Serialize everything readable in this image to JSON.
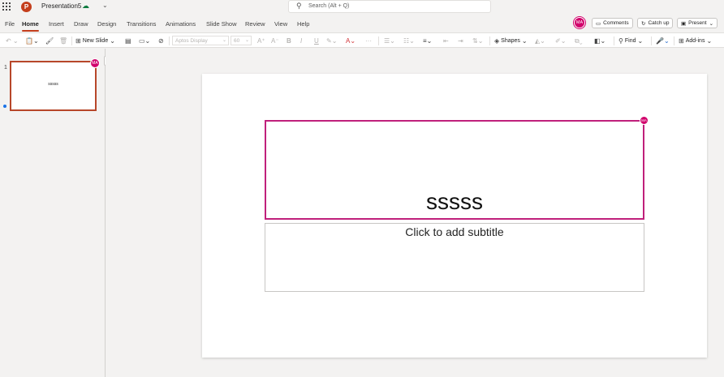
{
  "app": {
    "title": "Presentation5",
    "search_placeholder": "Search (Alt + Q)",
    "user_initials": "MA",
    "accent_color": "#c43e1c",
    "presence_color": "#d1006b"
  },
  "menu": {
    "tabs": [
      "File",
      "Home",
      "Insert",
      "Draw",
      "Design",
      "Transitions",
      "Animations",
      "Slide Show",
      "Review",
      "View",
      "Help"
    ],
    "active_tab": "Home"
  },
  "actions": {
    "comments": "Comments",
    "catch_up": "Catch up",
    "present": "Present"
  },
  "ribbon": {
    "new_slide": "New Slide",
    "font_name": "Aptos Display",
    "font_size": "60",
    "shapes": "Shapes",
    "find": "Find",
    "addins": "Add-ins"
  },
  "thumbnails": [
    {
      "number": "1",
      "text": "sssss"
    }
  ],
  "slide": {
    "title": "sssss",
    "subtitle_placeholder": "Click to add subtitle"
  }
}
